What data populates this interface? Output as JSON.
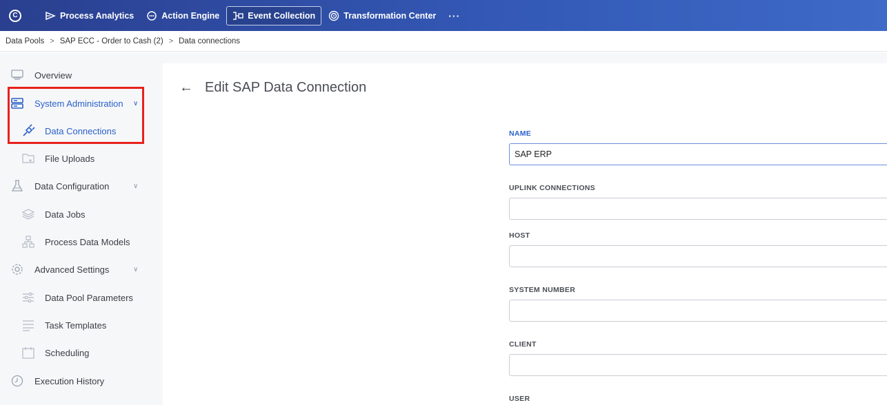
{
  "topbar": {
    "logo_letter": "C",
    "nav": [
      {
        "label": "Process Analytics",
        "icon": "process-analytics-icon"
      },
      {
        "label": "Action Engine",
        "icon": "action-engine-icon"
      },
      {
        "label": "Event Collection",
        "icon": "event-collection-icon",
        "active": true
      },
      {
        "label": "Transformation Center",
        "icon": "transformation-center-icon"
      }
    ],
    "more": "···"
  },
  "breadcrumb": {
    "items": [
      "Data Pools",
      "SAP ECC - Order to Cash (2)",
      "Data connections"
    ],
    "separator": ">"
  },
  "sidebar": {
    "items": [
      {
        "label": "Overview",
        "icon": "monitor-icon"
      },
      {
        "label": "System Administration",
        "icon": "server-icon"
      },
      {
        "label": "Data Connections",
        "icon": "plug-icon"
      },
      {
        "label": "File Uploads",
        "icon": "folder-icon"
      },
      {
        "label": "Data Configuration",
        "icon": "flask-icon"
      },
      {
        "label": "Data Jobs",
        "icon": "layers-icon"
      },
      {
        "label": "Process Data Models",
        "icon": "hierarchy-icon"
      },
      {
        "label": "Advanced Settings",
        "icon": "gear-icon"
      },
      {
        "label": "Data Pool Parameters",
        "icon": "sliders-icon"
      },
      {
        "label": "Task Templates",
        "icon": "list-icon"
      },
      {
        "label": "Scheduling",
        "icon": "calendar-icon"
      },
      {
        "label": "Execution History",
        "icon": "clock-icon"
      }
    ]
  },
  "form": {
    "title": "Edit SAP Data Connection",
    "fields": [
      {
        "label": "NAME",
        "value": "SAP ERP"
      },
      {
        "label": "UPLINK CONNECTIONS",
        "value": ""
      },
      {
        "label": "HOST",
        "value": ""
      },
      {
        "label": "SYSTEM NUMBER",
        "value": ""
      },
      {
        "label": "CLIENT",
        "value": ""
      },
      {
        "label": "USER",
        "value": ""
      }
    ]
  },
  "colors": {
    "accent": "#2a61c9",
    "topbar_start": "#2a3f8f",
    "topbar_end": "#3e6ac8",
    "highlight": "#e8211b"
  }
}
